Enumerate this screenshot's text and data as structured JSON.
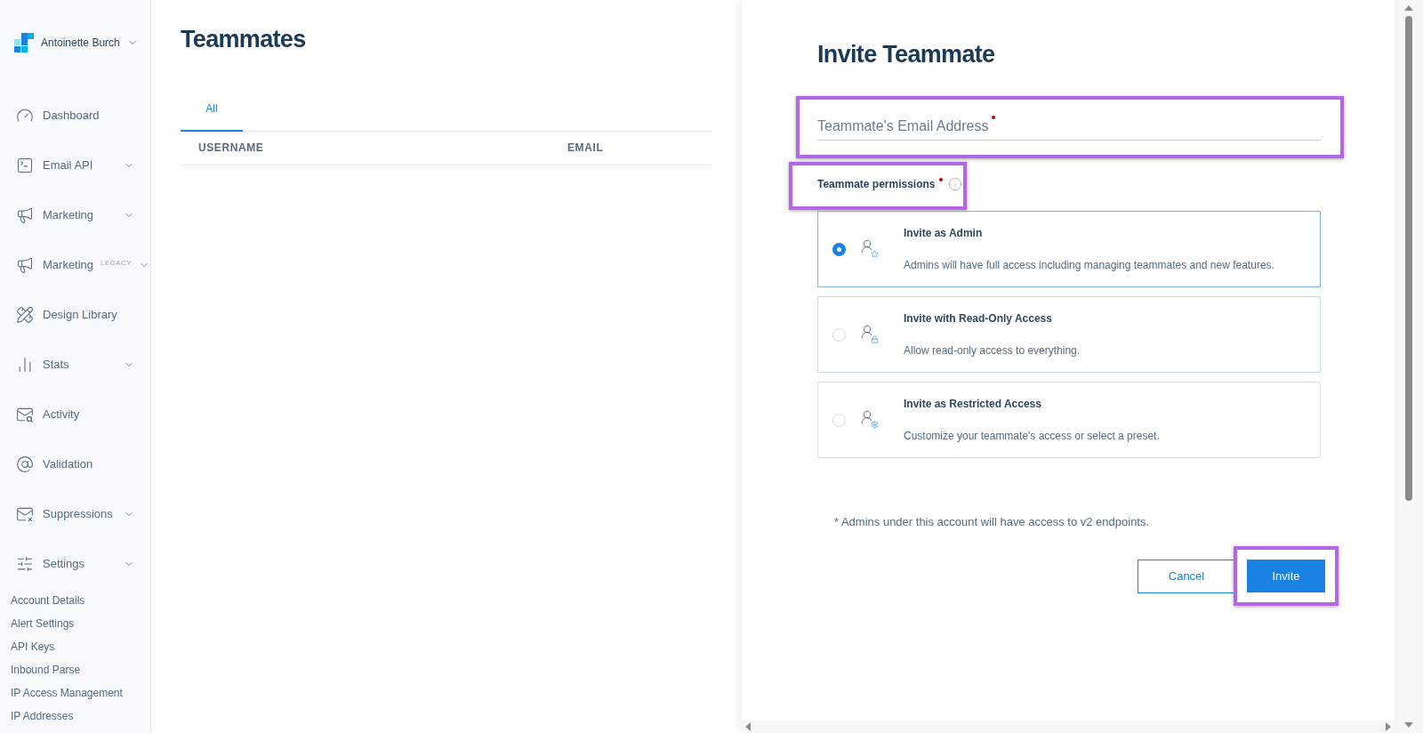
{
  "sidebar": {
    "account": {
      "name": "Antoinette Burch"
    },
    "items": [
      {
        "label": "Dashboard",
        "kind": "link"
      },
      {
        "label": "Email API",
        "kind": "group"
      },
      {
        "label": "Marketing",
        "kind": "group"
      },
      {
        "label": "Marketing",
        "badge": "LEGACY",
        "kind": "group"
      },
      {
        "label": "Design Library",
        "kind": "link"
      },
      {
        "label": "Stats",
        "kind": "group"
      },
      {
        "label": "Activity",
        "kind": "link"
      },
      {
        "label": "Validation",
        "kind": "link"
      },
      {
        "label": "Suppressions",
        "kind": "group"
      },
      {
        "label": "Settings",
        "kind": "group",
        "children": [
          {
            "label": "Account Details"
          },
          {
            "label": "Alert Settings"
          },
          {
            "label": "API Keys"
          },
          {
            "label": "Inbound Parse"
          },
          {
            "label": "IP Access Management"
          },
          {
            "label": "IP Addresses"
          }
        ]
      }
    ]
  },
  "main": {
    "title": "Teammates",
    "tabs": [
      {
        "label": "All",
        "selected": true
      }
    ],
    "table": {
      "columns": [
        "USERNAME",
        "EMAIL"
      ]
    }
  },
  "drawer": {
    "title": "Invite Teammate",
    "email_field": {
      "placeholder": "Teammate's Email Address",
      "required": true
    },
    "permissions": {
      "label": "Teammate permissions",
      "required": true
    },
    "options": [
      {
        "title": "Invite as Admin",
        "description": "Admins will have full access including managing teammates and new features.",
        "selected": true
      },
      {
        "title": "Invite with Read-Only Access",
        "description": "Allow read-only access to everything.",
        "selected": false
      },
      {
        "title": "Invite as Restricted Access",
        "description": "Customize your teammate's access or select a preset.",
        "selected": false
      }
    ],
    "footnote": "* Admins under this account will have access to v2 endpoints.",
    "buttons": {
      "cancel": "Cancel",
      "invite": "Invite"
    }
  }
}
